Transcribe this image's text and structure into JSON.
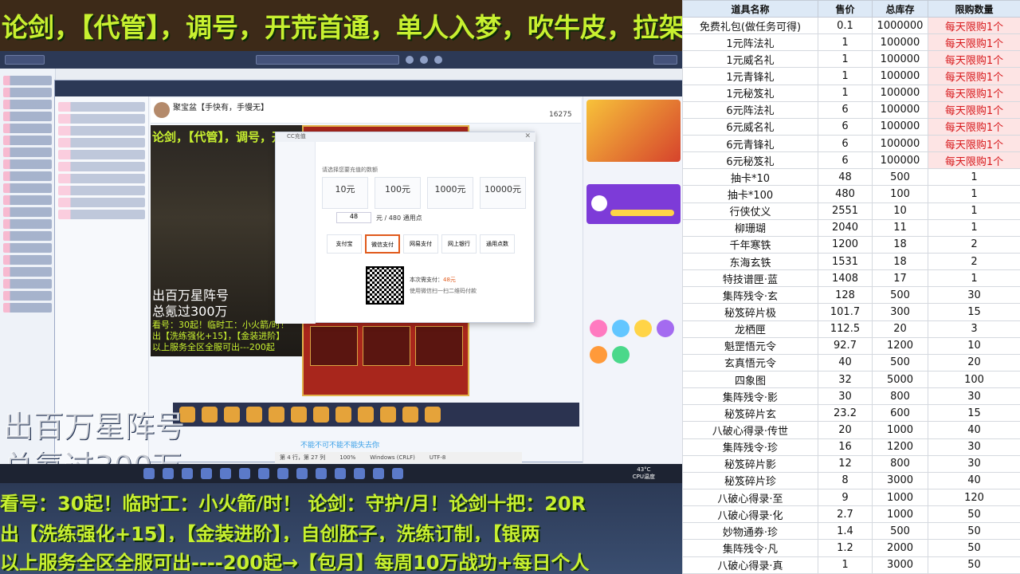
{
  "top_banner": "论剑，【代管】，调号，开荒首通，单人入梦，吹牛皮，拉架",
  "game_overlay": {
    "line1": "出百万星阵号",
    "line2": "总氪过300万",
    "line3": "看号：30起！临时工：小火箭/时！",
    "line4": "出【洗练强化+15】，【金装进阶】",
    "line5": "以上服务全区全服可出---200起"
  },
  "inner_banner": "论剑，【代管】，调号，开",
  "big_overlay": {
    "line1": "出百万星阵号",
    "line2": "总氪过300万"
  },
  "bottom_lines": [
    "看号：30起！临时工：小火箭/时！ 论剑：守护/月！论剑十把：20R",
    "出【洗练强化+15】，【金装进阶】，自创胚子，洗练订制，【银两",
    "以上服务全区全服可出----200起→【包月】每周10万战功+每日个人"
  ],
  "stream_header": {
    "streamer": "聚宝盆【手快有，手慢无】",
    "viewers": "16275"
  },
  "pay_dialog": {
    "title": "CC充值",
    "prompt": "请选择您要充值的数额",
    "amounts": [
      "10元",
      "100元",
      "1000元",
      "10000元"
    ],
    "custom_value": "48",
    "custom_hint": "元 / 480 通用点",
    "methods": [
      "支付宝",
      "微信支付",
      "网易支付",
      "网上银行",
      "通用点数"
    ],
    "pay_amount_label": "本次需支付：",
    "pay_amount": "48元",
    "scan_hint": "使用微信扫一扫二维码付款"
  },
  "status_bar": {
    "position": "第 4 行，第 27 列",
    "zoom": "100%",
    "eol": "Windows (CRLF)",
    "encoding": "UTF-8"
  },
  "taskbar": {
    "temp": "43°C",
    "cpu": "CPU温度"
  },
  "chat_notice": "不能不可不能不能失去你",
  "price_table": {
    "headers": [
      "道具名称",
      "售价",
      "总库存",
      "限购数量"
    ],
    "rows": [
      [
        "免费礼包(做任务可得)",
        "0.1",
        "1000000",
        "每天限购1个"
      ],
      [
        "1元阵法礼",
        "1",
        "100000",
        "每天限购1个"
      ],
      [
        "1元威名礼",
        "1",
        "100000",
        "每天限购1个"
      ],
      [
        "1元青锋礼",
        "1",
        "100000",
        "每天限购1个"
      ],
      [
        "1元秘笈礼",
        "1",
        "100000",
        "每天限购1个"
      ],
      [
        "6元阵法礼",
        "6",
        "100000",
        "每天限购1个"
      ],
      [
        "6元威名礼",
        "6",
        "100000",
        "每天限购1个"
      ],
      [
        "6元青锋礼",
        "6",
        "100000",
        "每天限购1个"
      ],
      [
        "6元秘笈礼",
        "6",
        "100000",
        "每天限购1个"
      ],
      [
        "抽卡*10",
        "48",
        "500",
        "1"
      ],
      [
        "抽卡*100",
        "480",
        "100",
        "1"
      ],
      [
        "行侠仗义",
        "2551",
        "10",
        "1"
      ],
      [
        "柳珊瑚",
        "2040",
        "11",
        "1"
      ],
      [
        "千年寒铁",
        "1200",
        "18",
        "2"
      ],
      [
        "东海玄铁",
        "1531",
        "18",
        "2"
      ],
      [
        "特技谱匣·蓝",
        "1408",
        "17",
        "1"
      ],
      [
        "集阵残令·玄",
        "128",
        "500",
        "30"
      ],
      [
        "秘笈碎片极",
        "101.7",
        "300",
        "15"
      ],
      [
        "龙栖匣",
        "112.5",
        "20",
        "3"
      ],
      [
        "魁罡悟元令",
        "92.7",
        "1200",
        "10"
      ],
      [
        "玄真悟元令",
        "40",
        "500",
        "20"
      ],
      [
        "四象图",
        "32",
        "5000",
        "100"
      ],
      [
        "集阵残令·影",
        "30",
        "800",
        "30"
      ],
      [
        "秘笈碎片玄",
        "23.2",
        "600",
        "15"
      ],
      [
        "八破心得录·传世",
        "20",
        "1000",
        "40"
      ],
      [
        "集阵残令·珍",
        "16",
        "1200",
        "30"
      ],
      [
        "秘笈碎片影",
        "12",
        "800",
        "30"
      ],
      [
        "秘笈碎片珍",
        "8",
        "3000",
        "40"
      ],
      [
        "八破心得录·至",
        "9",
        "1000",
        "120"
      ],
      [
        "八破心得录·化",
        "2.7",
        "1000",
        "50"
      ],
      [
        "妙物通券·珍",
        "1.4",
        "500",
        "50"
      ],
      [
        "集阵残令·凡",
        "1.2",
        "2000",
        "50"
      ],
      [
        "八破心得录·真",
        "1",
        "3000",
        "50"
      ]
    ]
  }
}
